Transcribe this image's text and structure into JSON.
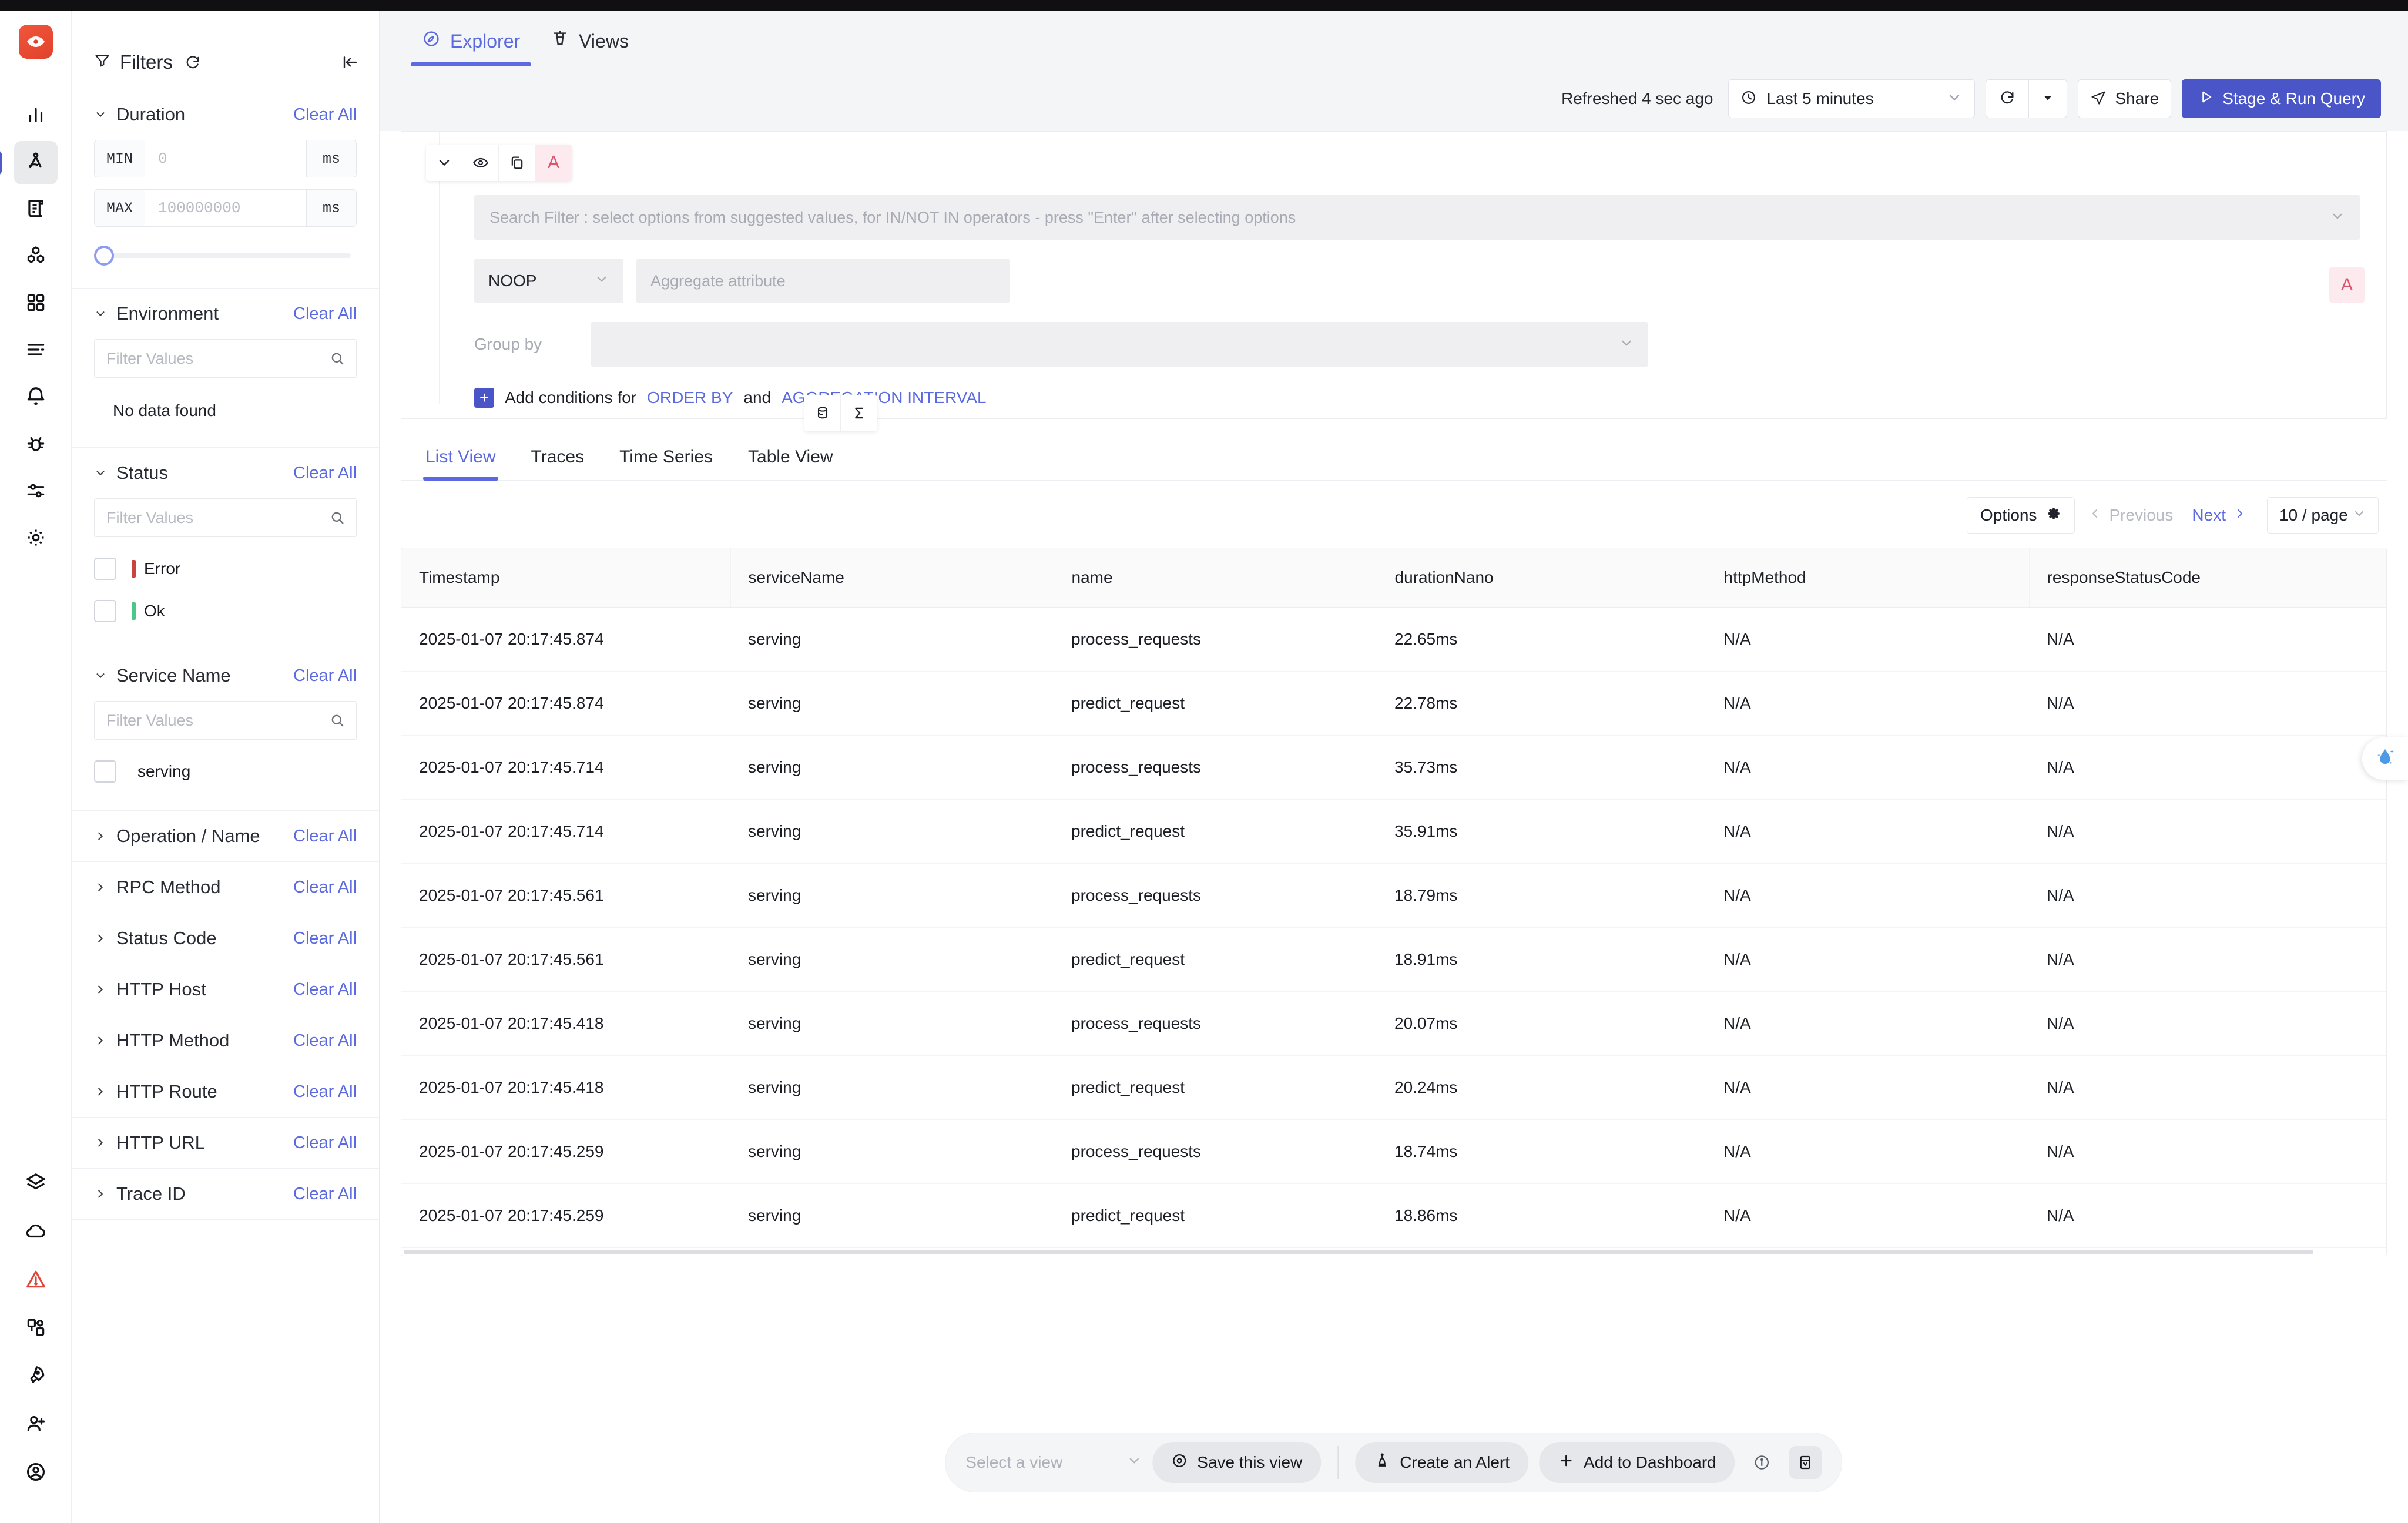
{
  "rail": {
    "logo_icon": "signoz-eye-logo",
    "items": [
      {
        "icon": "bar-chart-icon",
        "name": "dashboards-home",
        "active": false
      },
      {
        "icon": "compass-divider-icon",
        "name": "traces-explorer",
        "active": true
      },
      {
        "icon": "scroll-logs-icon",
        "name": "logs",
        "active": false
      },
      {
        "icon": "cubes-services-icon",
        "name": "services",
        "active": false
      },
      {
        "icon": "grid-dashboards-icon",
        "name": "dashboards",
        "active": false
      },
      {
        "icon": "list-lines-icon",
        "name": "list",
        "active": false
      },
      {
        "icon": "bell-alerts-icon",
        "name": "alerts",
        "active": false
      },
      {
        "icon": "bug-exceptions-icon",
        "name": "exceptions",
        "active": false
      },
      {
        "icon": "sliders-messaging-icon",
        "name": "messaging-queues",
        "active": false
      },
      {
        "icon": "gear-settings-icon",
        "name": "settings",
        "active": false
      }
    ],
    "bottom_items": [
      {
        "icon": "layers-icon",
        "name": "integrations"
      },
      {
        "icon": "cloud-icon",
        "name": "cloud"
      },
      {
        "icon": "warning-triangle-icon",
        "name": "alerts-warning"
      },
      {
        "icon": "puzzle-icon",
        "name": "plugins"
      },
      {
        "icon": "rocket-icon",
        "name": "onboarding"
      },
      {
        "icon": "user-plus-icon",
        "name": "invite-member"
      },
      {
        "icon": "user-circle-icon",
        "name": "account"
      }
    ]
  },
  "nav": {
    "tabs": [
      {
        "label": "Explorer",
        "icon": "compass-icon",
        "active": true
      },
      {
        "label": "Views",
        "icon": "control-tower-icon",
        "active": false
      }
    ]
  },
  "toolbar": {
    "refreshed_text": "Refreshed 4 sec ago",
    "time_range": "Last 5 minutes",
    "clock_icon": "clock-icon",
    "refresh_icon": "refresh-icon",
    "caret_icon": "caret-down-icon",
    "share_label": "Share",
    "share_icon": "send-share-icon",
    "run_label": "Stage & Run Query",
    "run_icon": "play-icon"
  },
  "filters": {
    "title": "Filters",
    "funnel_icon": "funnel-icon",
    "refresh_icon": "refresh-icon",
    "collapse_icon": "collapse-panel-icon",
    "clear_all_label": "Clear All",
    "filter_values_placeholder": "Filter Values",
    "search_icon": "search-icon",
    "duration": {
      "title": "Duration",
      "min_label": "MIN",
      "min_placeholder": "0",
      "max_label": "MAX",
      "max_placeholder": "100000000",
      "unit": "ms"
    },
    "environment": {
      "title": "Environment",
      "empty_text": "No data found"
    },
    "status": {
      "title": "Status",
      "options": [
        {
          "label": "Error",
          "color": "#c8443c",
          "checked": false
        },
        {
          "label": "Ok",
          "color": "#4cc78a",
          "checked": false
        }
      ]
    },
    "service_name": {
      "title": "Service Name",
      "options": [
        {
          "label": "serving",
          "checked": false
        }
      ]
    },
    "collapsed_sections": [
      {
        "title": "Operation / Name"
      },
      {
        "title": "RPC Method"
      },
      {
        "title": "Status Code"
      },
      {
        "title": "HTTP Host"
      },
      {
        "title": "HTTP Method"
      },
      {
        "title": "HTTP Route"
      },
      {
        "title": "HTTP URL"
      },
      {
        "title": "Trace ID"
      }
    ]
  },
  "query_builder": {
    "chips": [
      {
        "icon": "chevron-down-icon",
        "name": "collapse-query"
      },
      {
        "icon": "eye-icon",
        "name": "toggle-visibility"
      },
      {
        "icon": "copy-icon",
        "name": "clone-query"
      },
      {
        "icon": "query-letter",
        "label": "A"
      }
    ],
    "bottom_chips": [
      {
        "icon": "database-query-icon",
        "name": "add-query"
      },
      {
        "icon": "sigma-formula-icon",
        "name": "add-formula"
      }
    ],
    "right_badge": "A",
    "search_placeholder": "Search Filter : select options from suggested values, for IN/NOT IN operators - press \"Enter\" after selecting options",
    "aggregate_operator": "NOOP",
    "aggregate_attribute_placeholder": "Aggregate attribute",
    "group_by_label": "Group by",
    "add_conditions_prefix": "Add conditions for",
    "order_by_link": "ORDER BY",
    "and_text": "and",
    "aggregation_interval_link": "AGGREGATION INTERVAL"
  },
  "results": {
    "view_tabs": [
      {
        "label": "List View",
        "active": true
      },
      {
        "label": "Traces",
        "active": false
      },
      {
        "label": "Time Series",
        "active": false
      },
      {
        "label": "Table View",
        "active": false
      }
    ],
    "options_label": "Options",
    "options_icon": "gear-icon",
    "previous_label": "Previous",
    "next_label": "Next",
    "page_size": "10 / page",
    "columns": [
      "Timestamp",
      "serviceName",
      "name",
      "durationNano",
      "httpMethod",
      "responseStatusCode"
    ],
    "rows": [
      [
        "2025-01-07 20:17:45.874",
        "serving",
        "process_requests",
        "22.65ms",
        "N/A",
        "N/A"
      ],
      [
        "2025-01-07 20:17:45.874",
        "serving",
        "predict_request",
        "22.78ms",
        "N/A",
        "N/A"
      ],
      [
        "2025-01-07 20:17:45.714",
        "serving",
        "process_requests",
        "35.73ms",
        "N/A",
        "N/A"
      ],
      [
        "2025-01-07 20:17:45.714",
        "serving",
        "predict_request",
        "35.91ms",
        "N/A",
        "N/A"
      ],
      [
        "2025-01-07 20:17:45.561",
        "serving",
        "process_requests",
        "18.79ms",
        "N/A",
        "N/A"
      ],
      [
        "2025-01-07 20:17:45.561",
        "serving",
        "predict_request",
        "18.91ms",
        "N/A",
        "N/A"
      ],
      [
        "2025-01-07 20:17:45.418",
        "serving",
        "process_requests",
        "20.07ms",
        "N/A",
        "N/A"
      ],
      [
        "2025-01-07 20:17:45.418",
        "serving",
        "predict_request",
        "20.24ms",
        "N/A",
        "N/A"
      ],
      [
        "2025-01-07 20:17:45.259",
        "serving",
        "process_requests",
        "18.74ms",
        "N/A",
        "N/A"
      ],
      [
        "2025-01-07 20:17:45.259",
        "serving",
        "predict_request",
        "18.86ms",
        "N/A",
        "N/A"
      ]
    ]
  },
  "bottom_bar": {
    "select_view_placeholder": "Select a view",
    "save_view_label": "Save this view",
    "save_view_icon": "disc-save-icon",
    "create_alert_label": "Create an Alert",
    "create_alert_icon": "alert-bell-icon",
    "add_dashboard_label": "Add to Dashboard",
    "add_dashboard_icon": "plus-icon",
    "info_icon": "info-circle-icon",
    "panel_icon": "panel-collapse-icon"
  },
  "floating": {
    "icon": "sparkle-droplet-icon"
  },
  "colors": {
    "accent": "#5b6ae0",
    "primary_button": "#4a56c8",
    "error": "#c8443c",
    "ok": "#4cc78a",
    "query_letter": "#d9566f"
  }
}
